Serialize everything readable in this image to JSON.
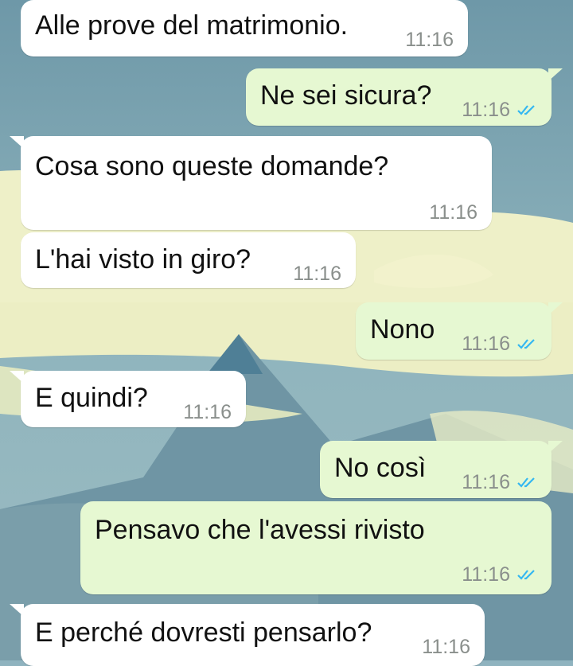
{
  "colors": {
    "incoming_bubble": "#ffffff",
    "outgoing_bubble": "#e6f8d2",
    "timestamp": "#8a8f8c",
    "read_ticks": "#34b7f1"
  },
  "messages": [
    {
      "direction": "incoming",
      "text": "Alle prove del matrimonio.",
      "time": "11:16"
    },
    {
      "direction": "outgoing",
      "text": "Ne sei sicura?",
      "time": "11:16",
      "status_icon": "double-check-read-icon"
    },
    {
      "direction": "incoming",
      "text": "Cosa sono queste domande?",
      "time": "11:16"
    },
    {
      "direction": "incoming",
      "text": "L'hai visto in giro?",
      "time": "11:16"
    },
    {
      "direction": "outgoing",
      "text": "Nono",
      "time": "11:16",
      "status_icon": "double-check-read-icon"
    },
    {
      "direction": "incoming",
      "text": "E quindi?",
      "time": "11:16"
    },
    {
      "direction": "outgoing",
      "text": "No così",
      "time": "11:16",
      "status_icon": "double-check-read-icon"
    },
    {
      "direction": "outgoing",
      "text": "Pensavo che l'avessi rivisto",
      "time": "11:16",
      "status_icon": "double-check-read-icon"
    },
    {
      "direction": "incoming",
      "text": "E perché dovresti pensarlo?",
      "time": "11:16"
    }
  ]
}
